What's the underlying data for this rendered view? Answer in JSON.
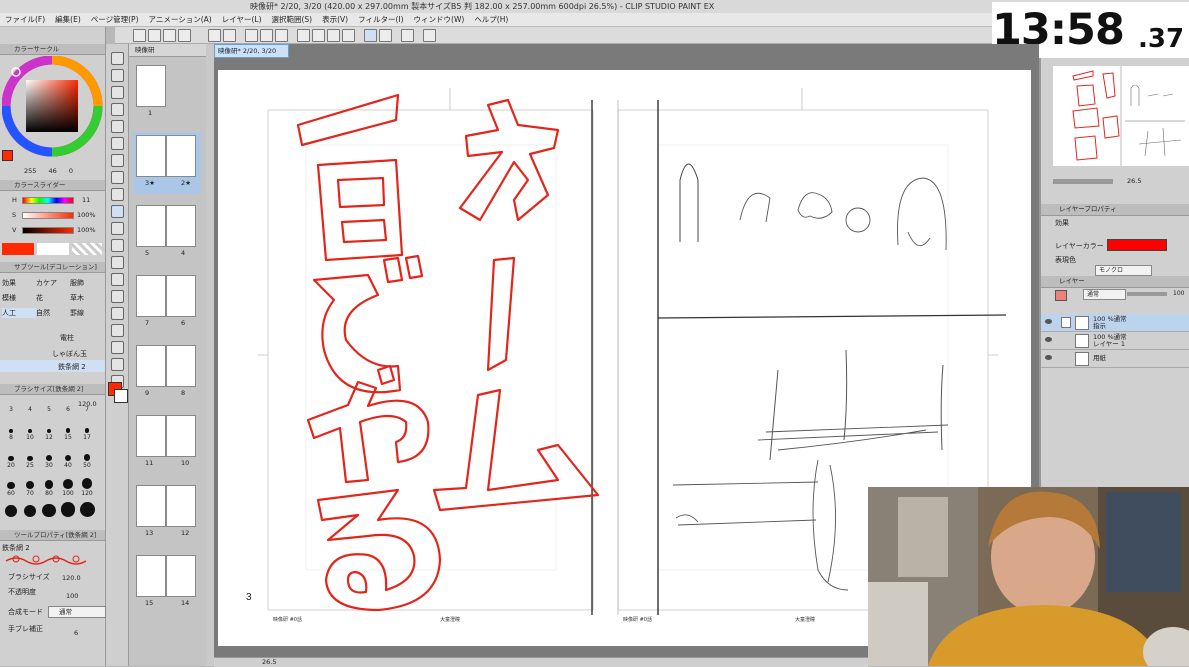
{
  "window": {
    "title": "映像研* 2/20, 3/20 (420.00 x 297.00mm 製本サイズB5 判 182.00 x 257.00mm 600dpi 26.5%) - CLIP STUDIO PAINT EX"
  },
  "menu": [
    "ファイル(F)",
    "編集(E)",
    "ページ管理(P)",
    "アニメーション(A)",
    "レイヤー(L)",
    "選択範囲(S)",
    "表示(V)",
    "フィルター(I)",
    "ウィンドウ(W)",
    "ヘルプ(H)"
  ],
  "clock": {
    "time": "13:58",
    "seconds": ".37"
  },
  "left_panel": {
    "color_circle_label": "カラーサークル",
    "rgb_values": [
      "255",
      "46",
      "0"
    ],
    "color_slider_label": "カラースライダー",
    "hsv": [
      {
        "label": "H",
        "value": "11"
      },
      {
        "label": "S",
        "value": "100"
      },
      {
        "label": "V",
        "value": "100"
      }
    ],
    "percent": "%",
    "sub_tool_label": "サブツール[デコレーション]",
    "sub_tools": [
      [
        "効果",
        "カケア",
        "服飾"
      ],
      [
        "模様",
        "花",
        "草木"
      ],
      [
        "人工",
        "自然",
        "罫線"
      ]
    ],
    "brush_names": [
      "電柱",
      "しゃぼん玉",
      "鉄条網 2"
    ],
    "brush_size_label": "ブラシサイズ[鉄条網 2]",
    "brush_size_value": "120.0",
    "brush_sizes": [
      "3",
      "4",
      "5",
      "6",
      "7",
      "8",
      "10",
      "12",
      "15",
      "17",
      "20",
      "25",
      "30",
      "40",
      "50",
      "60",
      "70",
      "80",
      "100",
      "120"
    ],
    "tool_property_label": "ツールプロパティ[鉄条網 2]",
    "tool_property_name": "鉄条網 2",
    "props": [
      {
        "label": "ブラシサイズ",
        "value": "120.0"
      },
      {
        "label": "不透明度",
        "value": "100"
      },
      {
        "label": "合成モード",
        "value": "通常"
      },
      {
        "label": "手ブレ補正",
        "value": "6"
      }
    ]
  },
  "page_panel": {
    "tab": "映像研",
    "thumbs": [
      {
        "labels": [
          "1"
        ]
      },
      {
        "labels": [
          "3★",
          "2★"
        ]
      },
      {
        "labels": [
          "5",
          "4"
        ]
      },
      {
        "labels": [
          "7",
          "6"
        ]
      },
      {
        "labels": [
          "9",
          "8"
        ]
      },
      {
        "labels": [
          "11",
          "10"
        ]
      },
      {
        "labels": [
          "13",
          "12"
        ]
      },
      {
        "labels": [
          "15",
          "14"
        ]
      }
    ]
  },
  "doc": {
    "tab": "映像研* 2/20, 3/20",
    "page_number": "3",
    "footer_left_1": "映像研 #0話",
    "footer_mid_1": "大童澄瞳",
    "footer_left_2": "映像研 #0話",
    "footer_mid_2": "大童澄瞳"
  },
  "right_panel": {
    "zoom_value": "26.5",
    "layer_property_label": "レイヤープロパティ",
    "effect_label": "効果",
    "layer_color_label": "レイヤーカラー",
    "expression_color_label": "表現色",
    "expression_color_value": "モノクロ",
    "layer_tab": "レイヤー",
    "blend_mode": "通常",
    "opacity": "100",
    "layers": [
      {
        "name1": "100 %通常",
        "name2": "指示"
      },
      {
        "name1": "100 %通常",
        "name2": "レイヤー 1"
      },
      {
        "name1": "用紙",
        "name2": ""
      }
    ]
  },
  "status": {
    "zoom": "26.5"
  },
  "colors": {
    "main": "#ff2a00",
    "accent": "#e3261b",
    "bg": "#b8b8b8"
  }
}
